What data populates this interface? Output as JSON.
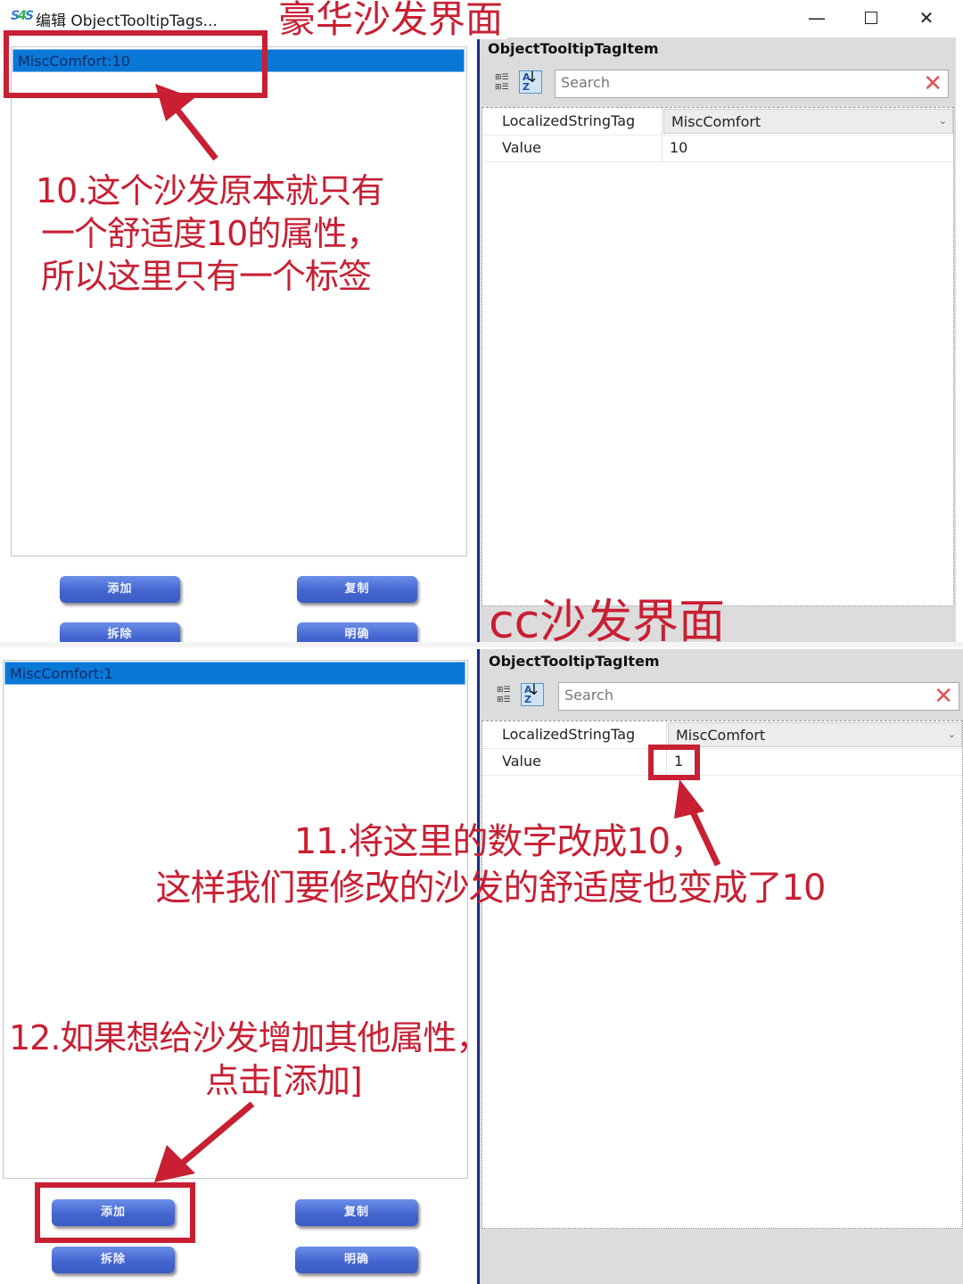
{
  "window": {
    "app_icon": "S4S",
    "title": "编辑 ObjectTooltipTags...",
    "controls": {
      "minimize_icon": "—",
      "maximize_icon": "square-icon",
      "close_icon": "✕"
    }
  },
  "top_section": {
    "heading": "豪华沙发界面",
    "list_items": [
      {
        "label": "MiscComfort:10",
        "selected": true
      }
    ],
    "buttons": {
      "add": "添加",
      "copy": "复制",
      "remove": "拆除",
      "clear": "明确"
    },
    "property_panel": {
      "header": "ObjectTooltipTagItem",
      "search_placeholder": "Search",
      "rows": [
        {
          "key": "LocalizedStringTag",
          "value": "MiscComfort",
          "dropdown": true
        },
        {
          "key": "Value",
          "value": "10"
        }
      ]
    },
    "note": [
      "10.这个沙发原本就只有",
      "一个舒适度10的属性，",
      "所以这里只有一个标签"
    ]
  },
  "bottom_section": {
    "heading": "cc沙发界面",
    "list_items": [
      {
        "label": "MiscComfort:1",
        "selected": true
      }
    ],
    "buttons": {
      "add": "添加",
      "copy": "复制",
      "remove": "拆除",
      "clear": "明确"
    },
    "property_panel": {
      "header": "ObjectTooltipTagItem",
      "search_placeholder": "Search",
      "rows": [
        {
          "key": "LocalizedStringTag",
          "value": "MiscComfort",
          "dropdown": true
        },
        {
          "key": "Value",
          "value": "1"
        }
      ]
    },
    "note_value": [
      "11.将这里的数字改成10，",
      "这样我们要修改的沙发的舒适度也变成了10"
    ],
    "note_add": [
      "12.如果想给沙发增加其他属性，",
      "点击[添加]"
    ]
  },
  "colors": {
    "annotation_red": "#c81f33",
    "selection_blue": "#0a78d7",
    "button_blue": "#4465cf"
  }
}
